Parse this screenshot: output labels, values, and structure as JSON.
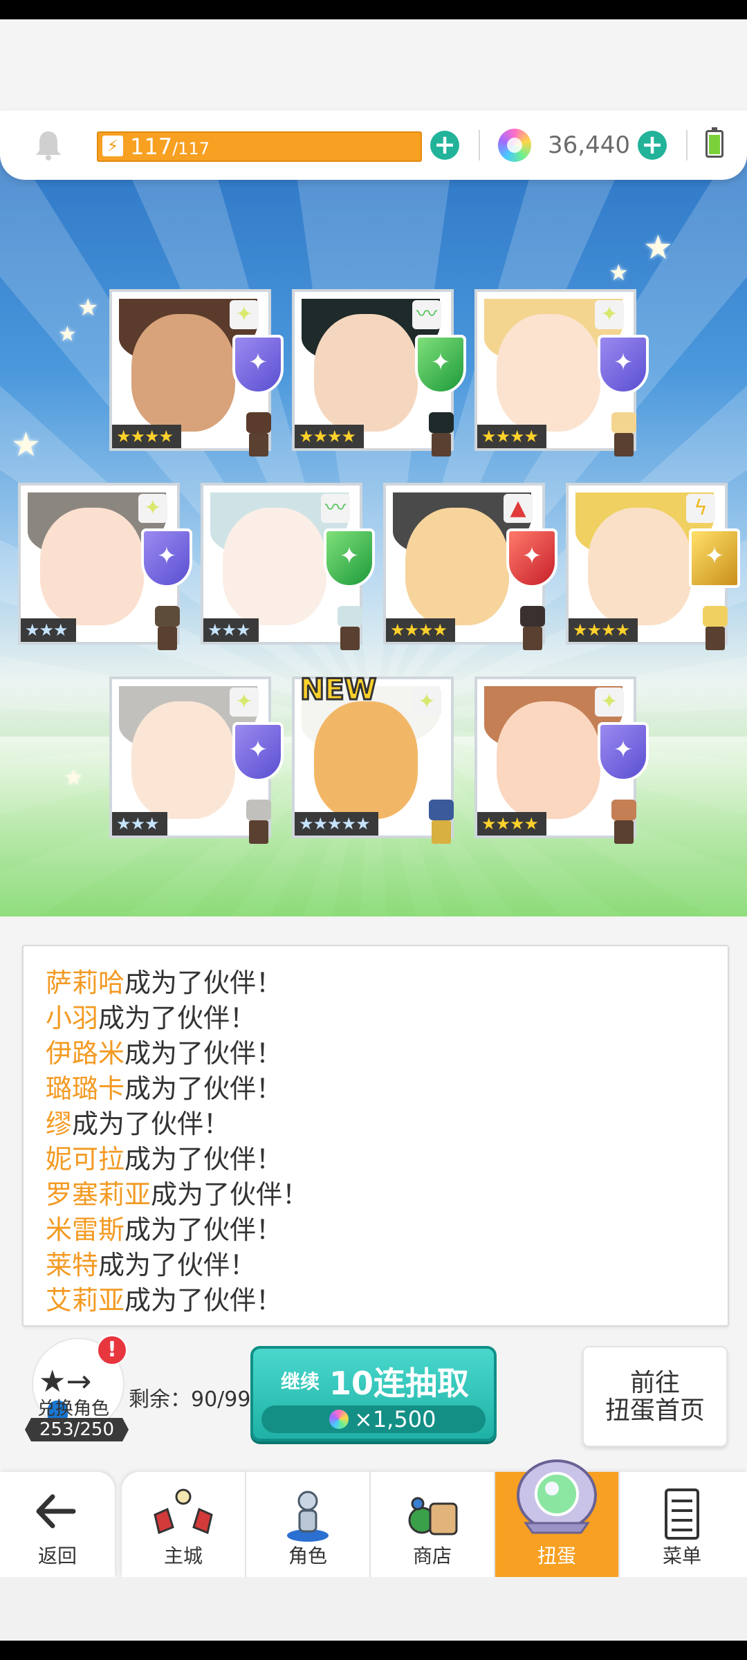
{
  "resources": {
    "stamina_current": "117",
    "stamina_max": "/117",
    "gems": "36,440",
    "plus_label": "+"
  },
  "results": [
    {
      "rarity": "★★★★",
      "element": "light",
      "is_new": false
    },
    {
      "rarity": "★★★★",
      "element": "wind",
      "is_new": false
    },
    {
      "rarity": "★★★★",
      "element": "light",
      "is_new": false
    },
    {
      "rarity": "★★★",
      "element": "light",
      "is_new": false
    },
    {
      "rarity": "★★★",
      "element": "wind",
      "is_new": false
    },
    {
      "rarity": "★★★★",
      "element": "fire",
      "is_new": false
    },
    {
      "rarity": "★★★★",
      "element": "thunder",
      "is_new": false
    },
    {
      "rarity": "★★★",
      "element": "light",
      "is_new": false
    },
    {
      "rarity": "★★★★★",
      "element": "light",
      "is_new": true
    },
    {
      "rarity": "★★★★",
      "element": "light",
      "is_new": false
    }
  ],
  "new_label": "NEW",
  "log": [
    {
      "name": "萨莉哈",
      "text": "成为了伙伴！"
    },
    {
      "name": "小羽",
      "text": "成为了伙伴！"
    },
    {
      "name": "伊路米",
      "text": "成为了伙伴！"
    },
    {
      "name": "璐璐卡",
      "text": "成为了伙伴！"
    },
    {
      "name": "缪",
      "text": "成为了伙伴！"
    },
    {
      "name": "妮可拉",
      "text": "成为了伙伴！"
    },
    {
      "name": "罗塞莉亚",
      "text": "成为了伙伴！"
    },
    {
      "name": "米雷斯",
      "text": "成为了伙伴！"
    },
    {
      "name": "莱特",
      "text": "成为了伙伴！"
    },
    {
      "name": "艾莉亚",
      "text": "成为了伙伴！"
    }
  ],
  "exchange": {
    "label": "兑换角色",
    "count": "253/250",
    "alert": "!",
    "remaining": "剩余：90/99"
  },
  "pull_button": {
    "prefix": "继续",
    "label": "10连抽取",
    "cost": "×1,500"
  },
  "home_button": {
    "line1": "前往",
    "line2": "扭蛋首页"
  },
  "tabs": {
    "back": "返回",
    "city": "主城",
    "character": "角色",
    "shop": "商店",
    "gacha": "扭蛋",
    "menu": "菜单"
  },
  "colors": {
    "accent": "#f7a022",
    "teal": "#1fb1a5",
    "name_orange": "#f39a22"
  }
}
